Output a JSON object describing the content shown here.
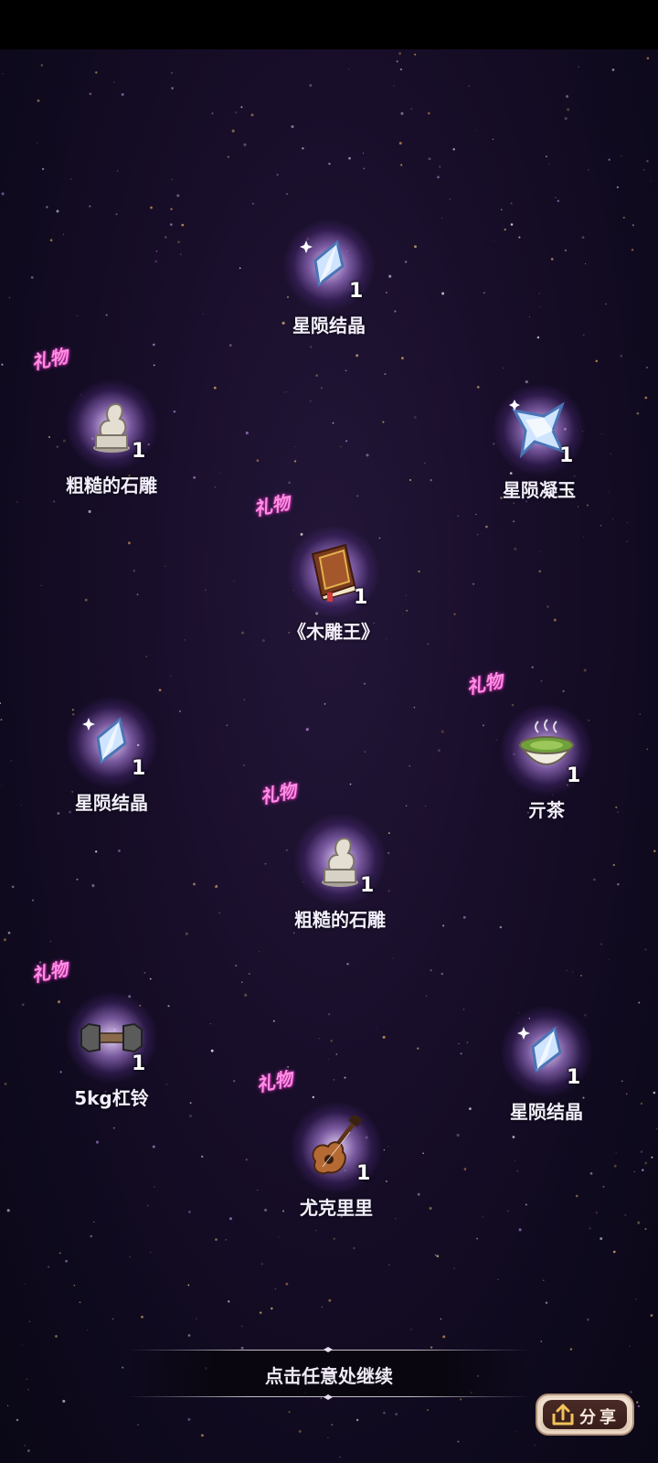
{
  "rewards": [
    {
      "name": "星陨结晶",
      "count": "1",
      "gift": false,
      "icon": "crystal-icon"
    },
    {
      "name": "粗糙的石雕",
      "count": "1",
      "gift": true,
      "gift_label": "礼物",
      "icon": "stone-statue-icon"
    },
    {
      "name": "星陨凝玉",
      "count": "1",
      "gift": false,
      "icon": "star-jade-icon"
    },
    {
      "name": "《木雕王》",
      "count": "1",
      "gift": true,
      "gift_label": "礼物",
      "icon": "book-icon"
    },
    {
      "name": "星陨结晶",
      "count": "1",
      "gift": false,
      "icon": "crystal-icon"
    },
    {
      "name": "亓茶",
      "count": "1",
      "gift": true,
      "gift_label": "礼物",
      "icon": "tea-bowl-icon"
    },
    {
      "name": "粗糙的石雕",
      "count": "1",
      "gift": true,
      "gift_label": "礼物",
      "icon": "stone-statue-icon"
    },
    {
      "name": "5kg杠铃",
      "count": "1",
      "gift": true,
      "gift_label": "礼物",
      "icon": "dumbbell-icon"
    },
    {
      "name": "星陨结晶",
      "count": "1",
      "gift": false,
      "icon": "crystal-icon"
    },
    {
      "name": "尤克里里",
      "count": "1",
      "gift": true,
      "gift_label": "礼物",
      "icon": "ukulele-icon"
    }
  ],
  "continue_text": "点击任意处继续",
  "share_label": "分享",
  "colors": {
    "gift_tag": "#ff8fe3",
    "background": "#170d28",
    "share_button": "#dcc4ae"
  }
}
